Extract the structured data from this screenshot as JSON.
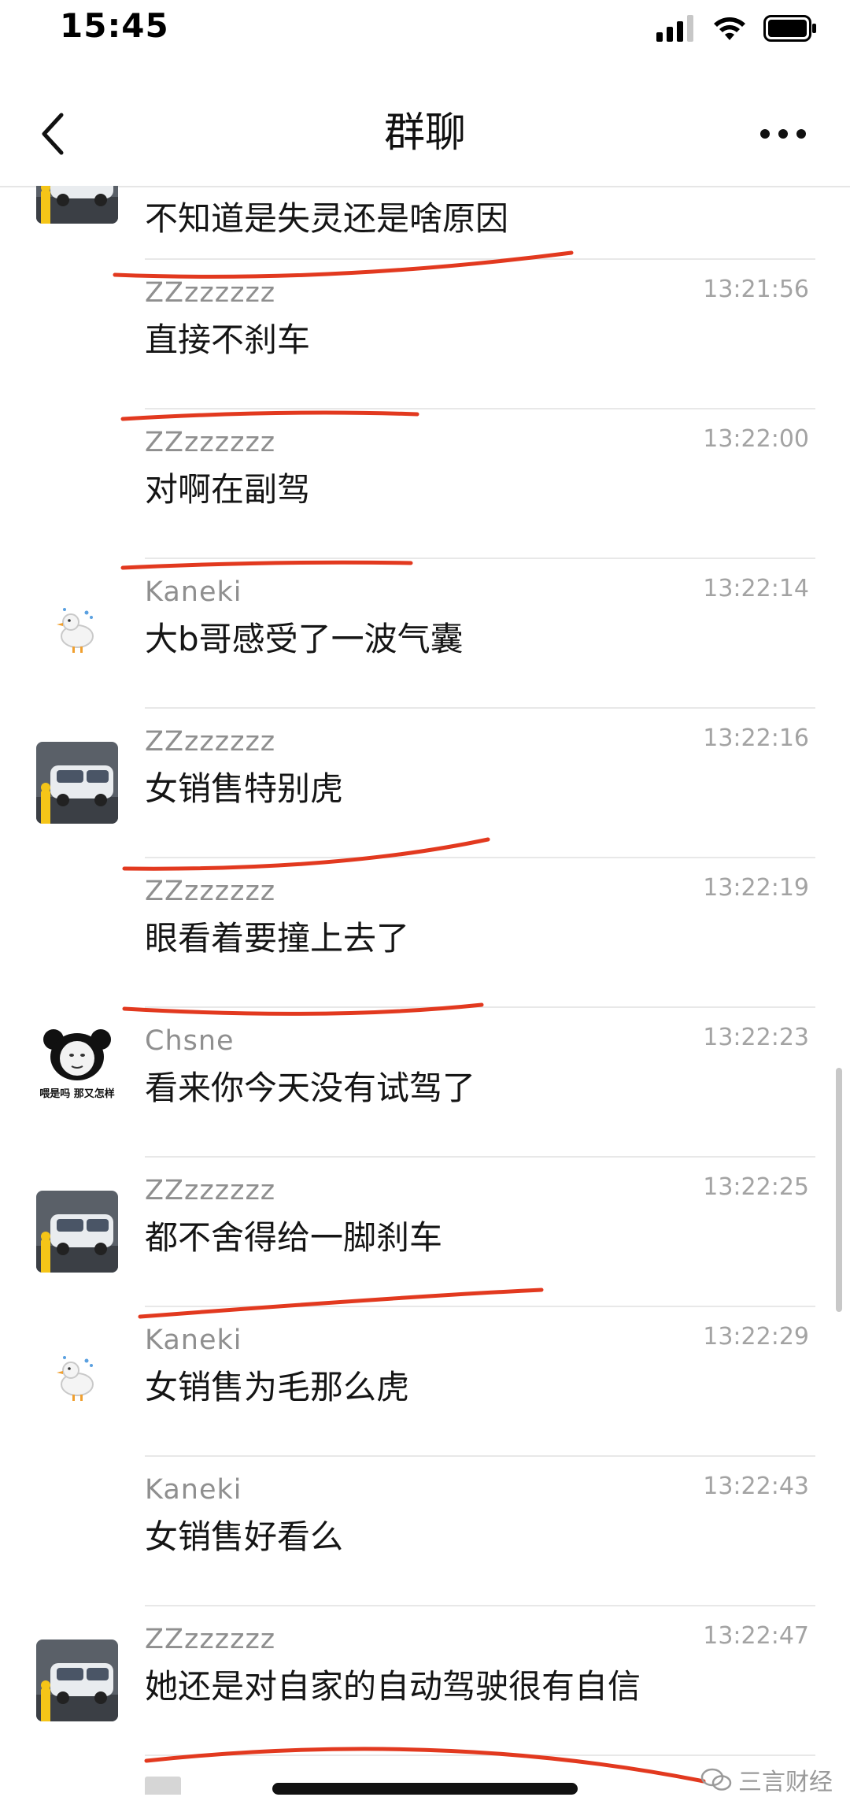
{
  "status_bar": {
    "time": "15:45"
  },
  "header": {
    "title": "群聊"
  },
  "messages": [
    {
      "text": "不知道是失灵还是啥原因"
    },
    {
      "sender": "ZZzzzzzz",
      "time": "13:21:56",
      "text": "直接不刹车"
    },
    {
      "sender": "ZZzzzzzz",
      "time": "13:22:00",
      "text": "对啊在副驾"
    },
    {
      "sender": "Kaneki",
      "time": "13:22:14",
      "text": "大b哥感受了一波气囊"
    },
    {
      "sender": "ZZzzzzzz",
      "time": "13:22:16",
      "text": "女销售特别虎"
    },
    {
      "sender": "ZZzzzzzz",
      "time": "13:22:19",
      "text": "眼看着要撞上去了"
    },
    {
      "sender": "Chsne",
      "time": "13:22:23",
      "text": "看来你今天没有试驾了"
    },
    {
      "sender": "ZZzzzzzz",
      "time": "13:22:25",
      "text": "都不舍得给一脚刹车"
    },
    {
      "sender": "Kaneki",
      "time": "13:22:29",
      "text": "女销售为毛那么虎"
    },
    {
      "sender": "Kaneki",
      "time": "13:22:43",
      "text": "女销售好看么"
    },
    {
      "sender": "ZZzzzzzz",
      "time": "13:22:47",
      "text": "她还是对自家的自动驾驶很有自信"
    }
  ],
  "avatars": {
    "panda_caption": "喂是吗 那又怎样"
  },
  "watermark": {
    "text": "三言财经"
  },
  "colors": {
    "annotation_red": "#e2391f",
    "sender_gray": "#8f8f8f"
  }
}
